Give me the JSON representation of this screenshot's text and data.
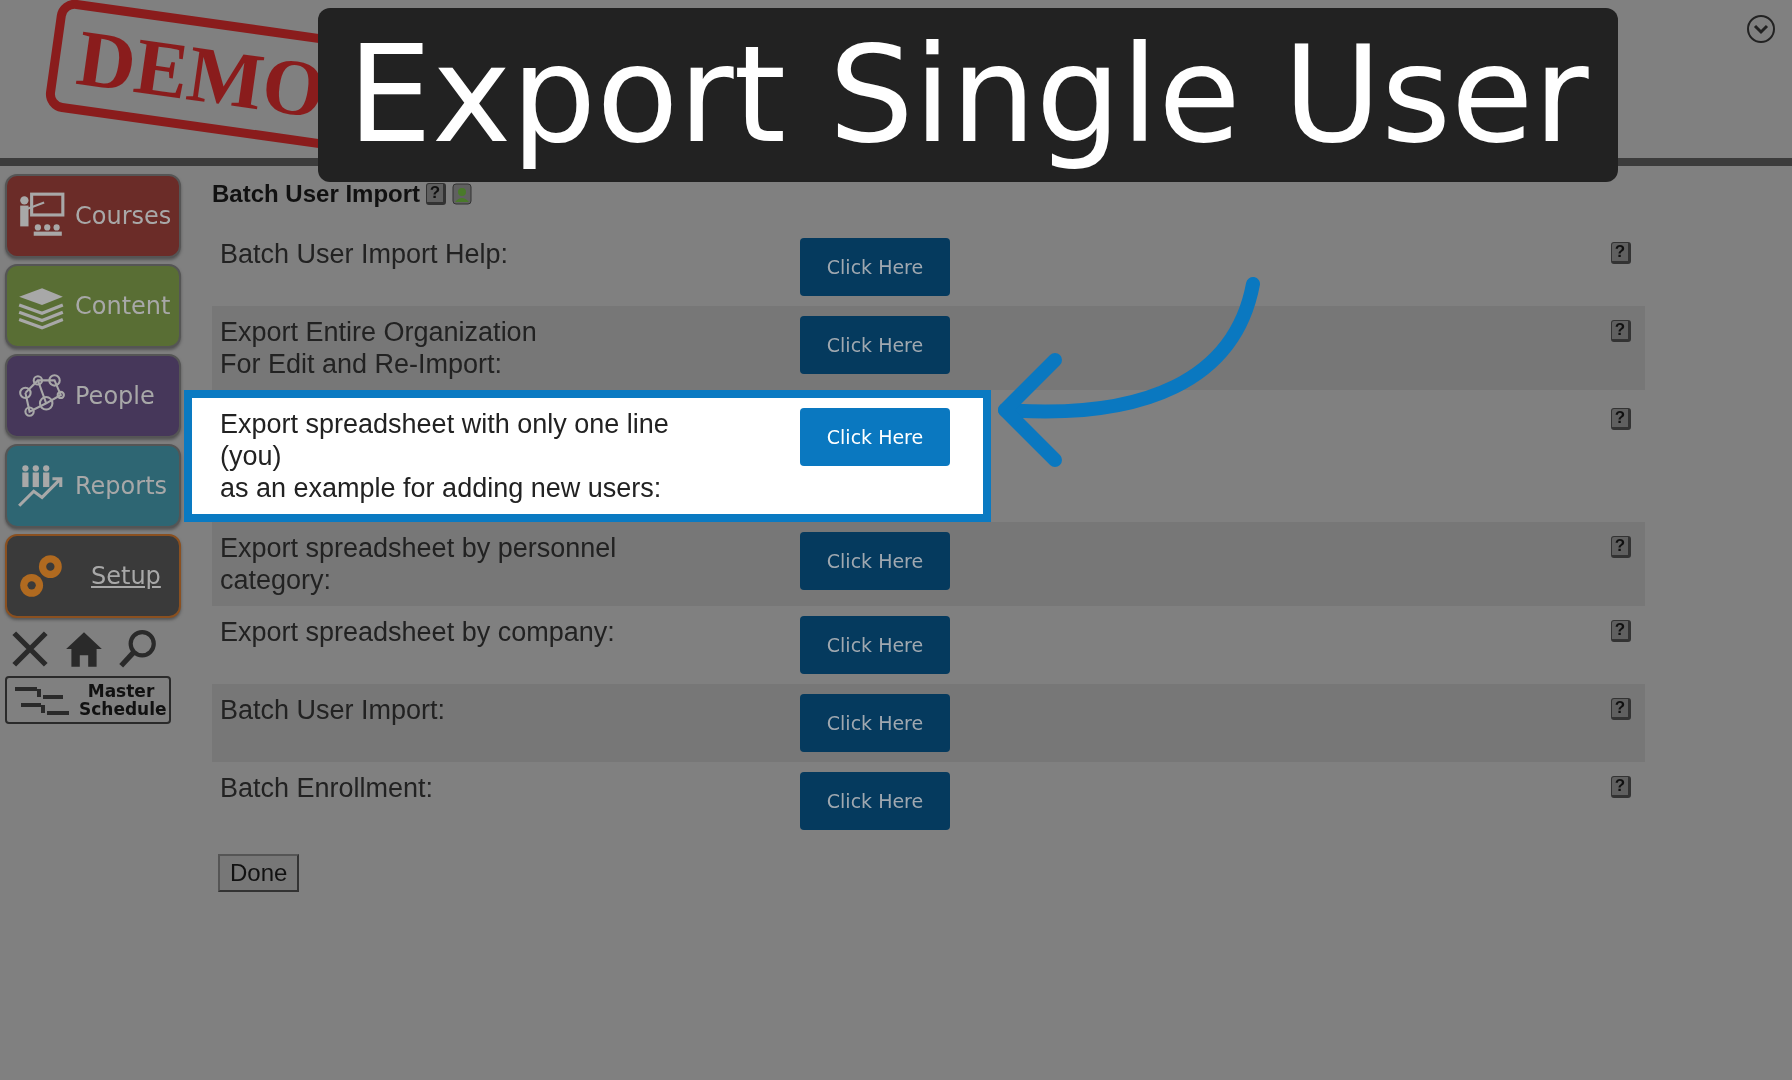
{
  "demo_stamp": "DEMO",
  "overlay_title": "Export Single User",
  "sidebar": {
    "items": [
      {
        "label": "Courses",
        "kind": "courses",
        "color": "#6b2c28",
        "selected": false
      },
      {
        "label": "Content",
        "kind": "content",
        "color": "#596e34",
        "selected": false
      },
      {
        "label": "People",
        "kind": "people",
        "color": "#46375a",
        "selected": false
      },
      {
        "label": "Reports",
        "kind": "reports",
        "color": "#2e6673",
        "selected": false
      },
      {
        "label": "Setup",
        "kind": "setup",
        "color": "#3a3a3a",
        "selected": true
      }
    ],
    "master_schedule": "Master Schedule"
  },
  "section": {
    "title": "Batch User Import",
    "help": "?"
  },
  "rows": [
    {
      "label": "Batch User Import Help:",
      "button": "Click Here",
      "help": "?",
      "highlighted": false
    },
    {
      "label": "Export Entire Organization\nFor Edit and Re-Import:",
      "button": "Click Here",
      "help": "?",
      "highlighted": false
    },
    {
      "label": "Export spreadsheet with only one line\n(you)\nas an example for adding new users:",
      "button": "Click Here",
      "help": "?",
      "highlighted": true
    },
    {
      "label": "Export spreadsheet by personnel\ncategory:",
      "button": "Click Here",
      "help": "?",
      "highlighted": false
    },
    {
      "label": "Export spreadsheet by company:",
      "button": "Click Here",
      "help": "?",
      "highlighted": false
    },
    {
      "label": "Batch User Import:",
      "button": "Click Here",
      "help": "?",
      "highlighted": false
    },
    {
      "label": "Batch Enrollment:",
      "button": "Click Here",
      "help": "?",
      "highlighted": false
    }
  ],
  "done_button": "Done"
}
